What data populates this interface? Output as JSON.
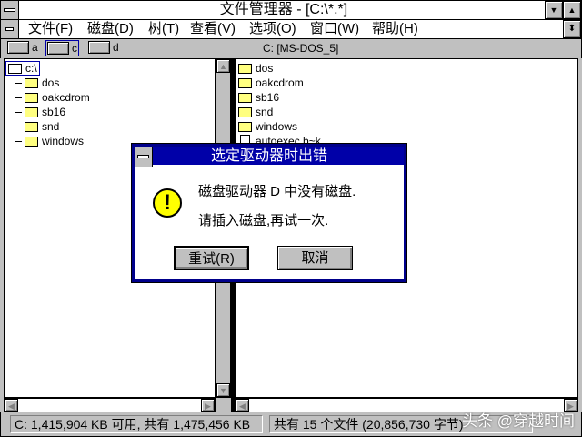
{
  "window": {
    "title": "文件管理器 - [C:\\*.*]"
  },
  "menu": [
    "文件(F)",
    "磁盘(D)",
    "树(T)",
    "查看(V)",
    "选项(O)",
    "窗口(W)",
    "帮助(H)"
  ],
  "drives": [
    {
      "letter": "a",
      "icon": "floppy-drive-icon"
    },
    {
      "letter": "c",
      "icon": "hard-drive-icon",
      "selected": true
    },
    {
      "letter": "d",
      "icon": "cdrom-drive-icon"
    }
  ],
  "volume_label": "C: [MS-DOS_5]",
  "tree": {
    "root": "c:\\",
    "children": [
      "dos",
      "oakcdrom",
      "sb16",
      "snd",
      "windows"
    ]
  },
  "files": [
    {
      "name": "dos",
      "type": "folder"
    },
    {
      "name": "oakcdrom",
      "type": "folder"
    },
    {
      "name": "sb16",
      "type": "folder"
    },
    {
      "name": "snd",
      "type": "folder"
    },
    {
      "name": "windows",
      "type": "folder"
    },
    {
      "name": "autoexec.b~k",
      "type": "file"
    }
  ],
  "dialog": {
    "title": "选定驱动器时出错",
    "line1": "磁盘驱动器 D 中没有磁盘.",
    "line2": "请插入磁盘,再试一次.",
    "retry": "重试(R)",
    "cancel": "取消"
  },
  "status": {
    "left": "C: 1,415,904 KB 可用, 共有 1,475,456 KB",
    "right": "共有 15 个文件 (20,856,730 字节)"
  },
  "watermark": "头条 @穿越时间"
}
